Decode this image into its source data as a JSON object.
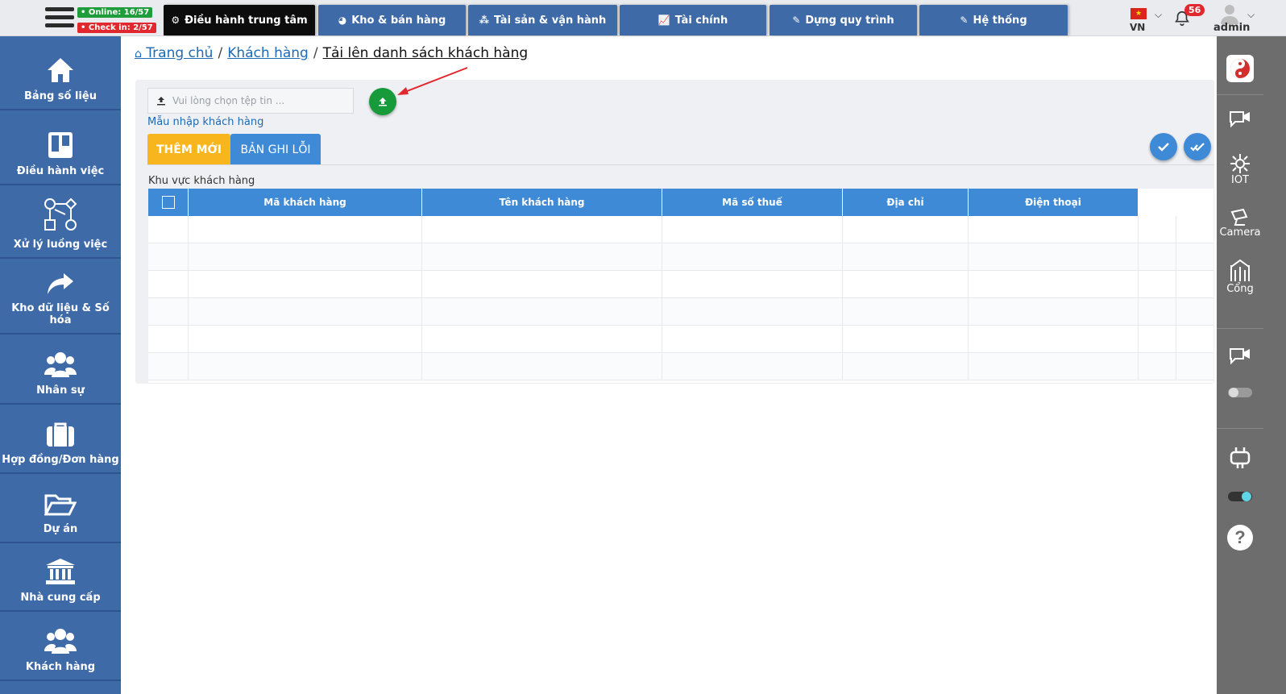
{
  "header": {
    "online_badge": "• Online: 16/57",
    "checkin_badge": "• Check in: 2/57",
    "nav_tabs": [
      {
        "label": "Điều hành trung tâm",
        "icon": "gear-icon",
        "active": true
      },
      {
        "label": "Kho & bán hàng",
        "icon": "pie-chart-icon",
        "active": false
      },
      {
        "label": "Tài sản & vận hành",
        "icon": "cubes-icon",
        "active": false
      },
      {
        "label": "Tài chính",
        "icon": "line-chart-icon",
        "active": false
      },
      {
        "label": "Dựng quy trình",
        "icon": "edit-icon",
        "active": false
      },
      {
        "label": "Hệ thống",
        "icon": "edit-icon",
        "active": false
      }
    ],
    "language": "VN",
    "notification_count": "56",
    "user": "admin"
  },
  "sidebar": {
    "items": [
      {
        "label": "Bảng số liệu",
        "icon": "home-icon"
      },
      {
        "label": "Điều hành việc",
        "icon": "board-icon"
      },
      {
        "label": "Xử lý luồng việc",
        "icon": "flow-icon"
      },
      {
        "label": "Kho dữ liệu & Số hóa",
        "icon": "share-arrow-icon"
      },
      {
        "label": "Nhân sự",
        "icon": "users-icon"
      },
      {
        "label": "Hợp đồng/Đơn hàng",
        "icon": "briefcase-icon"
      },
      {
        "label": "Dự án",
        "icon": "folder-open-icon"
      },
      {
        "label": "Nhà cung cấp",
        "icon": "bank-icon"
      },
      {
        "label": "Khách hàng",
        "icon": "users-icon"
      }
    ]
  },
  "right_sidebar": {
    "iot_label": "IOT",
    "camera_label": "Camera",
    "gate_label": "Cổng"
  },
  "breadcrumb": {
    "home": "Trang chủ",
    "parent": "Khách hàng",
    "current": "Tải lên danh sách khách hàng"
  },
  "upload": {
    "placeholder": "Vui lòng chọn tệp tin ...",
    "template_link": "Mẫu nhập khách hàng"
  },
  "tabs": {
    "new": "THÊM MỚI",
    "errors": "BẢN GHI LỖI"
  },
  "region_label": "Khu vực khách hàng",
  "table": {
    "columns": [
      "Mã khách hàng",
      "Tên khách hàng",
      "Mã số thuế",
      "Địa chỉ",
      "Điện thoại"
    ],
    "rows": []
  },
  "colors": {
    "brand_blue": "#3e6aa8",
    "accent_blue": "#3e8ad6",
    "tab_orange": "#f8b51e",
    "upload_green": "#179a3a",
    "badge_red": "#e0282e"
  }
}
